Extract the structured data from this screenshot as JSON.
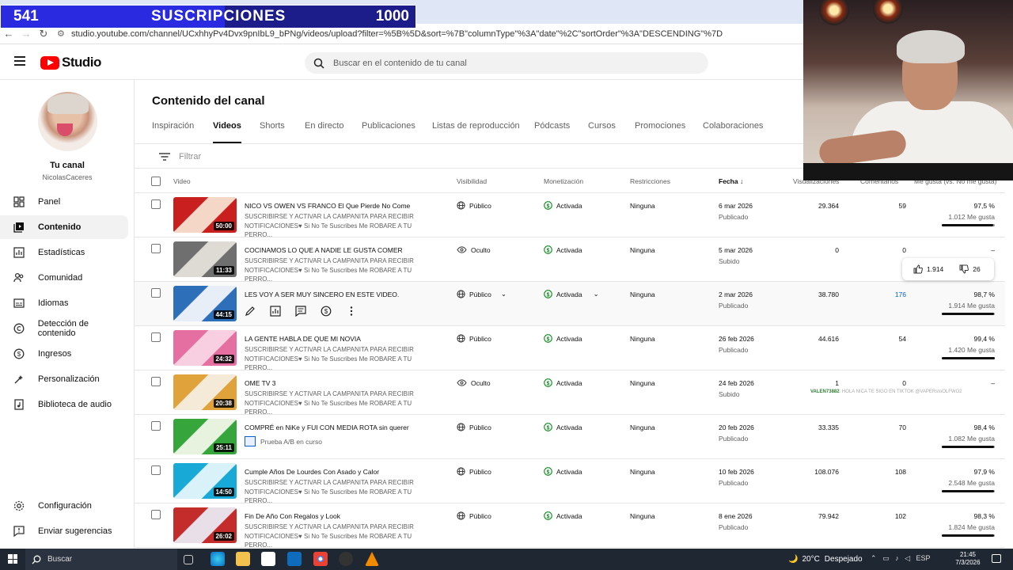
{
  "overlay": {
    "left": "541",
    "center": "SUSCRIPCIONES",
    "right": "1000",
    "progress": 0.54
  },
  "browser": {
    "url": "studio.youtube.com/channel/UCxhhyPv4Dvx9pnIbL9_bPNg/videos/upload?filter=%5B%5D&sort=%7B\"columnType\"%3A\"date\"%2C\"sortOrder\"%3A\"DESCENDING\"%7D"
  },
  "header": {
    "logo_text": "Studio",
    "search_placeholder": "Buscar en el contenido de tu canal"
  },
  "sidebar": {
    "channel_title": "Tu canal",
    "channel_handle": "NicolasCaceres",
    "items": [
      {
        "label": "Panel",
        "icon": "dashboard-icon"
      },
      {
        "label": "Contenido",
        "icon": "content-icon",
        "active": true
      },
      {
        "label": "Estadísticas",
        "icon": "analytics-icon"
      },
      {
        "label": "Comunidad",
        "icon": "community-icon"
      },
      {
        "label": "Idiomas",
        "icon": "subtitles-icon"
      },
      {
        "label": "Detección de contenido",
        "icon": "copyright-icon"
      },
      {
        "label": "Ingresos",
        "icon": "earn-icon"
      },
      {
        "label": "Personalización",
        "icon": "customization-icon"
      },
      {
        "label": "Biblioteca de audio",
        "icon": "audio-library-icon"
      }
    ],
    "bottom": [
      {
        "label": "Configuración",
        "icon": "settings-icon"
      },
      {
        "label": "Enviar sugerencias",
        "icon": "feedback-icon"
      }
    ]
  },
  "main": {
    "title": "Contenido del canal",
    "tabs": [
      "Inspiración",
      "Videos",
      "Shorts",
      "En directo",
      "Publicaciones",
      "Listas de reproducción",
      "Pódcasts",
      "Cursos",
      "Promociones",
      "Colaboraciones"
    ],
    "active_tab": "Videos",
    "filter_placeholder": "Filtrar",
    "columns": {
      "video": "Video",
      "visibility": "Visibilidad",
      "monetization": "Monetización",
      "restrictions": "Restricciones",
      "date": "Fecha",
      "views": "Visualizaciones",
      "comments": "Comentarios",
      "likes": "Me gusta (vs. No me gusta)"
    }
  },
  "videos": [
    {
      "title": "NICO VS OWEN VS FRANCO El Que Pierde No Come",
      "desc": "SUSCRIBIRSE Y ACTIVAR LA CAMPANITA PARA RECIBIR NOTIFICACIONES♥ Si No Te Suscribes Me ROBARE A TU PERRO...",
      "duration": "50:00",
      "visibility": "Público",
      "monetization": "Activada",
      "restrictions": "Ninguna",
      "date": "6 mar 2026",
      "status": "Publicado",
      "views": "29.364",
      "comments": "59",
      "likes_pct": "97,5 %",
      "likes_count": "1.012 Me gusta",
      "like_ratio": 0.975,
      "colors": [
        "#c9201f",
        "#f4d7c6"
      ]
    },
    {
      "title": "COCINAMOS LO QUE A NADIE LE GUSTA COMER",
      "desc": "SUSCRIBIRSE Y ACTIVAR LA CAMPANITA PARA RECIBIR NOTIFICACIONES♥ Si No Te Suscribes Me ROBARE A TU PERRO...",
      "duration": "11:33",
      "visibility": "Oculto",
      "monetization": "Activada",
      "restrictions": "Ninguna",
      "date": "5 mar 2026",
      "status": "Subido",
      "views": "0",
      "comments": "0",
      "likes_pct": "–",
      "likes_count": "",
      "like_ratio": null,
      "colors": [
        "#6f6f6f",
        "#dedad4"
      ]
    },
    {
      "title": "LES VOY A SER MUY SINCERO EN ESTE VIDEO.",
      "desc": "",
      "duration": "44:15",
      "visibility": "Público",
      "monetization": "Activada",
      "restrictions": "Ninguna",
      "date": "2 mar 2026",
      "status": "Publicado",
      "views": "38.780",
      "comments": "176",
      "likes_pct": "98,7 %",
      "likes_count": "1.914 Me gusta",
      "like_ratio": 0.987,
      "colors": [
        "#2d6fb8",
        "#e8eef7"
      ]
    },
    {
      "title": "LA GENTE HABLA DE QUE MI NOVIA",
      "desc": "SUSCRIBIRSE Y ACTIVAR LA CAMPANITA PARA RECIBIR NOTIFICACIONES♥ Si No Te Suscribes Me ROBARE A TU PERRO...",
      "duration": "24:32",
      "visibility": "Público",
      "monetization": "Activada",
      "restrictions": "Ninguna",
      "date": "26 feb 2026",
      "status": "Publicado",
      "views": "44.616",
      "comments": "54",
      "likes_pct": "99,4 %",
      "likes_count": "1.420 Me gusta",
      "like_ratio": 0.994,
      "colors": [
        "#e46fa0",
        "#f7cfe0"
      ]
    },
    {
      "title": "OME TV 3",
      "desc": "SUSCRIBIRSE Y ACTIVAR LA CAMPANITA PARA RECIBIR NOTIFICACIONES♥ Si No Te Suscribes Me ROBARE A TU PERRO...",
      "duration": "20:38",
      "visibility": "Oculto",
      "monetization": "Activada",
      "restrictions": "Ninguna",
      "date": "24 feb 2026",
      "status": "Subido",
      "views": "1",
      "comments": "0",
      "likes_pct": "–",
      "likes_count": "",
      "like_ratio": null,
      "colors": [
        "#e0a23a",
        "#f4ead7"
      ]
    },
    {
      "title": "COMPRÉ en NiKe y FUI CON MEDIA ROTA sin querer",
      "desc": "",
      "duration": "25:11",
      "visibility": "Público",
      "monetization": "Activada",
      "restrictions": "Ninguna",
      "date": "20 feb 2026",
      "status": "Publicado",
      "views": "33.335",
      "comments": "70",
      "likes_pct": "98,4 %",
      "likes_count": "1.082 Me gusta",
      "like_ratio": 0.984,
      "colors": [
        "#36a53c",
        "#e7f2df"
      ],
      "ab_test": "Prueba A/B en curso"
    },
    {
      "title": "Cumple Años De Lourdes Con Asado y Calor",
      "desc": "SUSCRIBIRSE Y ACTIVAR LA CAMPANITA PARA RECIBIR NOTIFICACIONES♥ Si No Te Suscribes Me ROBARE A TU PERRO...",
      "duration": "14:50",
      "visibility": "Público",
      "monetization": "Activada",
      "restrictions": "Ninguna",
      "date": "10 feb 2026",
      "status": "Publicado",
      "views": "108.076",
      "comments": "108",
      "likes_pct": "97,9 %",
      "likes_count": "2.548 Me gusta",
      "like_ratio": 0.979,
      "colors": [
        "#19a9d6",
        "#d9f2fa"
      ]
    },
    {
      "title": "Fin De Año Con Regalos y Look",
      "desc": "SUSCRIBIRSE Y ACTIVAR LA CAMPANITA PARA RECIBIR NOTIFICACIONES♥ Si No Te Suscribes Me ROBARE A TU PERRO...",
      "duration": "26:02",
      "visibility": "Público",
      "monetization": "Activada",
      "restrictions": "Ninguna",
      "date": "8 ene 2026",
      "status": "Publicado",
      "views": "79.942",
      "comments": "102",
      "likes_pct": "98,3 %",
      "likes_count": "1.824 Me gusta",
      "like_ratio": 0.983,
      "colors": [
        "#c42b2b",
        "#e9dfe8"
      ]
    }
  ],
  "like_popup": {
    "likes": "1.914",
    "dislikes": "26"
  },
  "chat_line": {
    "user": "VALEN73882",
    "text": ": HOLA NICA TE SIGO EN TIKTOK @VAPERstoOLFWO2"
  },
  "taskbar": {
    "search_label": "Buscar",
    "weather": "20°C",
    "weather_text": "Despejado",
    "lang": "ESP",
    "time": "21:45",
    "date": "7/3/2026"
  }
}
